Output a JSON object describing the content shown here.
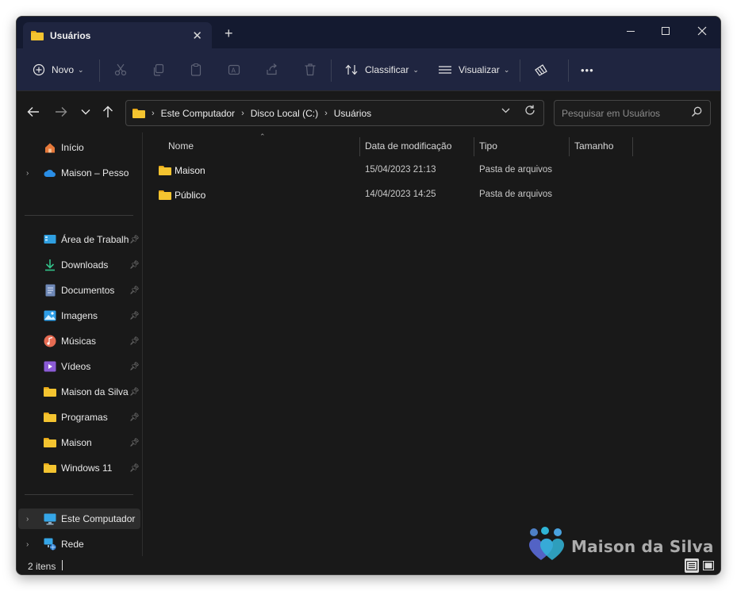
{
  "tab": {
    "title": "Usuários",
    "close": "✕",
    "new_tab": "+"
  },
  "window_controls": {
    "minimize": "—",
    "maximize": "☐",
    "close": "✕"
  },
  "toolbar": {
    "new_label": "Novo",
    "sort_label": "Classificar",
    "view_label": "Visualizar",
    "more": "•••"
  },
  "address": {
    "breadcrumbs": [
      "Este Computador",
      "Disco Local (C:)",
      "Usuários"
    ]
  },
  "search": {
    "placeholder": "Pesquisar em Usuários"
  },
  "sidebar": {
    "top": [
      {
        "label": "Início",
        "icon": "home-icon"
      },
      {
        "label": "Maison – Pessoal",
        "icon": "cloud-icon"
      }
    ],
    "quick": [
      {
        "label": "Área de Trabalho",
        "icon": "desktop-icon"
      },
      {
        "label": "Downloads",
        "icon": "download-icon"
      },
      {
        "label": "Documentos",
        "icon": "document-icon"
      },
      {
        "label": "Imagens",
        "icon": "image-icon"
      },
      {
        "label": "Músicas",
        "icon": "music-icon"
      },
      {
        "label": "Vídeos",
        "icon": "video-icon"
      },
      {
        "label": "Maison da Silva",
        "icon": "folder-icon"
      },
      {
        "label": "Programas",
        "icon": "folder-icon"
      },
      {
        "label": "Maison",
        "icon": "folder-icon"
      },
      {
        "label": "Windows 11",
        "icon": "folder-icon"
      }
    ],
    "bottom": [
      {
        "label": "Este Computador",
        "icon": "computer-icon"
      },
      {
        "label": "Rede",
        "icon": "network-icon"
      }
    ]
  },
  "columns": {
    "name": "Nome",
    "modified": "Data de modificação",
    "type": "Tipo",
    "size": "Tamanho"
  },
  "files": [
    {
      "name": "Maison",
      "modified": "15/04/2023 21:13",
      "type": "Pasta de arquivos"
    },
    {
      "name": "Público",
      "modified": "14/04/2023 14:25",
      "type": "Pasta de arquivos"
    }
  ],
  "status": {
    "items": "2 itens"
  },
  "watermark": {
    "text": "Maison da Silva"
  },
  "colors": {
    "accent": "#1f2540",
    "titlebar": "#141a30",
    "folder": "#f4c430",
    "background": "#191919"
  }
}
